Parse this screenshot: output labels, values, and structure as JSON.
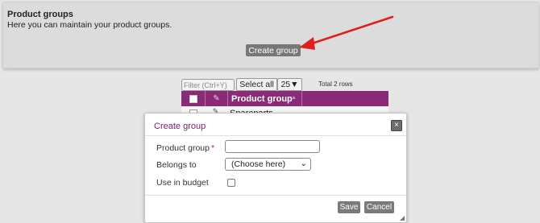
{
  "page": {
    "title": "Product groups",
    "description": "Here you can maintain your product groups.",
    "create_button": "Create group"
  },
  "toolbar": {
    "filter_placeholder": "Filter (Ctrl+Y)",
    "select_all": "Select all",
    "rows_per_page": "25▼",
    "total_rows": "Total 2 rows"
  },
  "table": {
    "column_header": "Product group",
    "rows": [
      {
        "product_group": "Spareparts"
      }
    ]
  },
  "dialog": {
    "title": "Create group",
    "close_glyph": "×",
    "fields": {
      "product_group_label": "Product group",
      "required_marker": "*",
      "belongs_to_label": "Belongs to",
      "belongs_to_value": "(Choose here)",
      "use_in_budget_label": "Use in budget"
    },
    "save": "Save",
    "cancel": "Cancel"
  },
  "colors": {
    "table_header": "#8a2a78",
    "dialog_title": "#7b1f6a",
    "annotation_arrow": "#e02020",
    "button": "#7a7a7a"
  },
  "icons": {
    "header_edit": "pencil-icon",
    "row_edit": "pencil-icon",
    "sort": "sort-asc-icon",
    "close": "close-icon"
  }
}
